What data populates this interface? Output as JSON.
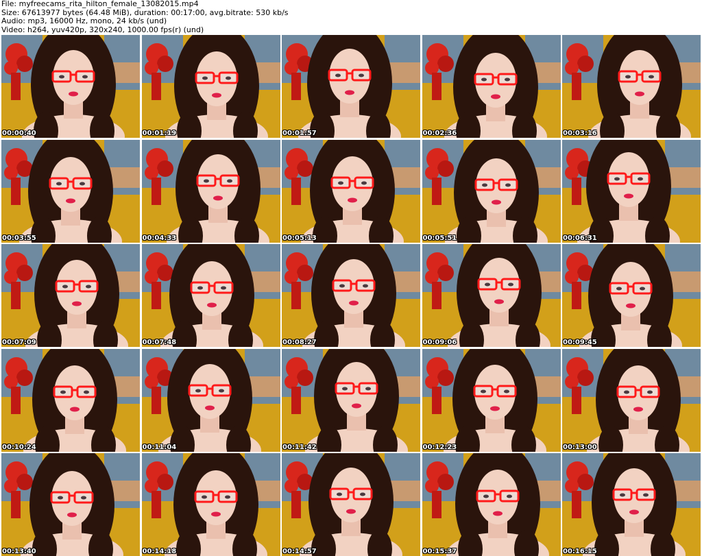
{
  "header": {
    "file": "File: myfreecams_rita_hilton_female_13082015.mp4",
    "size": "Size: 67613977 bytes (64.48 MiB), duration: 00:17:00, avg.bitrate: 530 kb/s",
    "audio": "Audio: mp3, 16000 Hz, mono, 24 kb/s (und)",
    "video": "Video: h264, yuv420p, 320x240, 1000.00 fps(r) (und)"
  },
  "thumbnails": [
    "00:00:40",
    "00:01:19",
    "00:01:57",
    "00:02:36",
    "00:03:16",
    "00:03:55",
    "00:04:33",
    "00:05:13",
    "00:05:51",
    "00:06:31",
    "00:07:09",
    "00:07:48",
    "00:08:27",
    "00:09:06",
    "00:09:45",
    "00:10:24",
    "00:11:04",
    "00:11:42",
    "00:12:23",
    "00:13:00",
    "00:13:40",
    "00:14:18",
    "00:14:57",
    "00:15:37",
    "00:16:15"
  ],
  "colors": {
    "wall": "#d2a01a",
    "painting_sky": "#6f8aa0",
    "flowers": "#d8261c",
    "hair": "#2a140c",
    "skin": "#f2d2c2",
    "glasses": "#ff1a1a",
    "lips": "#e0204a",
    "timestamp_text": "#ffffff"
  }
}
